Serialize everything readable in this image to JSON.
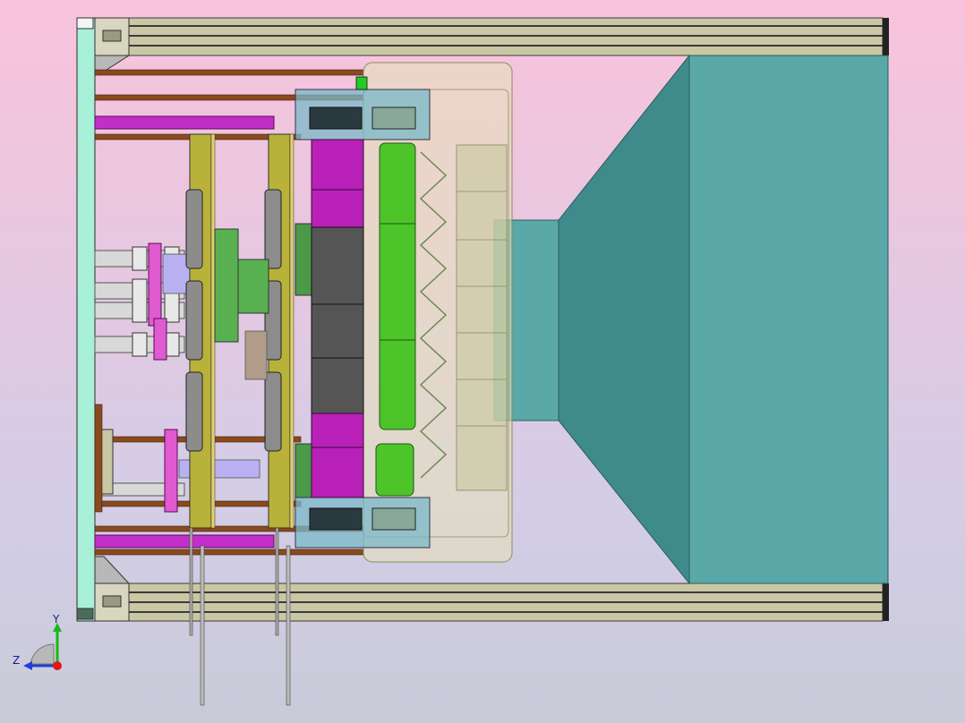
{
  "viewport": {
    "background_top": "#f9c3dc",
    "background_bottom": "#c9cbd8"
  },
  "model": {
    "colors": {
      "frame_beige": "#c9c7a4",
      "frame_dark": "#2b2b2b",
      "plate_mint": "#a8f0d8",
      "teal_hopper": "#5aa8a8",
      "teal_dark": "#3f8b8b",
      "rod_brown": "#8a4a1e",
      "magenta_cylinder": "#b820b8",
      "magenta_bar": "#e05ad0",
      "green_roller": "#4cc42a",
      "olive_plate": "#b9b23a",
      "gray_block": "#555555",
      "housing_glass": "#e8e2b8"
    }
  },
  "triad": {
    "y_label": "Y",
    "z_label": "Z",
    "y_color": "#18b818",
    "z_color": "#2040d8",
    "x_color": "#e01818"
  }
}
